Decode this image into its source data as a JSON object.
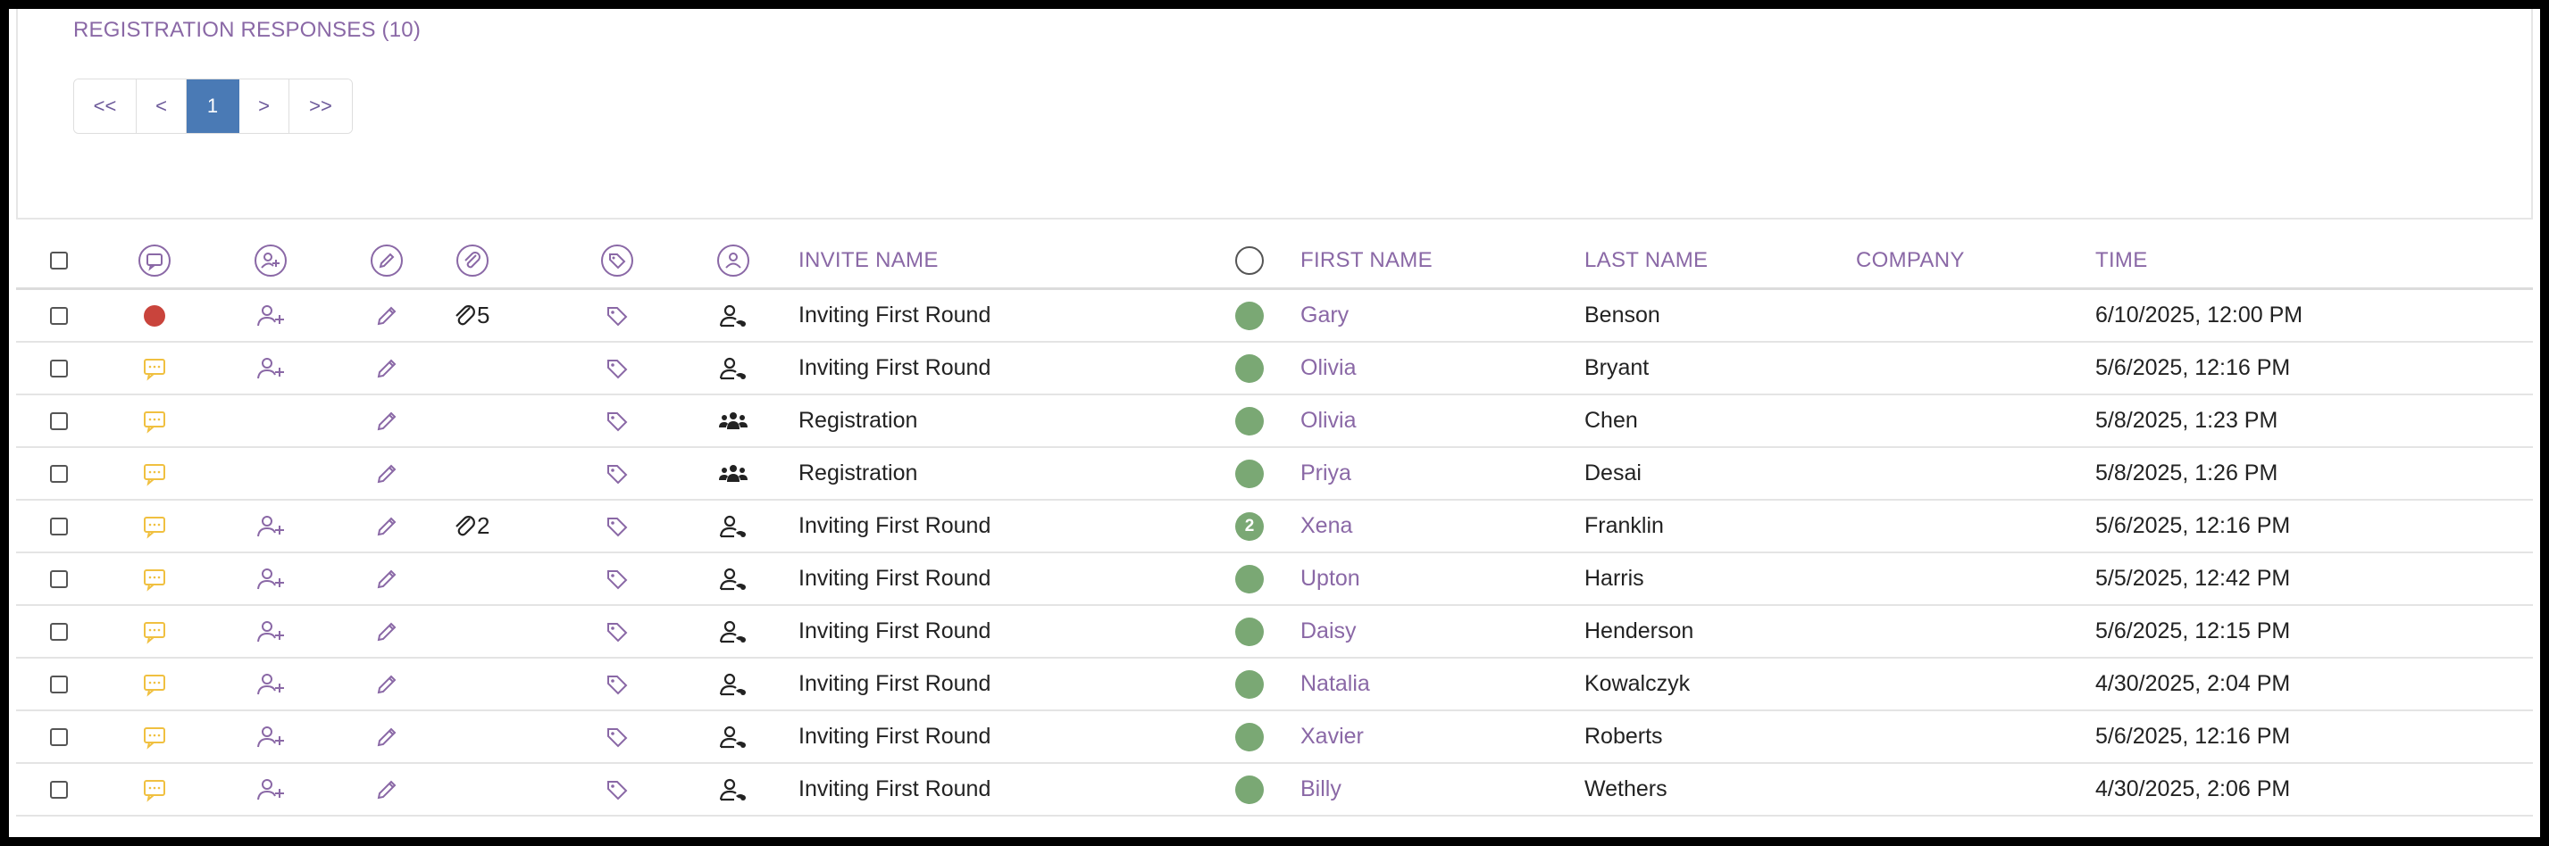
{
  "panel": {
    "title": "REGISTRATION RESPONSES (10)",
    "pager": {
      "first": "<<",
      "prev": "<",
      "current": "1",
      "next": ">",
      "last": ">>"
    }
  },
  "colors": {
    "accent_purple": "#8a68a6",
    "pager_active": "#4a7ab5",
    "status_green": "#7aa874",
    "alert_red": "#c9443c",
    "comment_yellow": "#f0c040"
  },
  "table": {
    "headers": {
      "comments": "comments-icon",
      "add_user": "user-plus-icon",
      "edit": "pencil-icon",
      "attachments": "paperclip-icon",
      "tags": "tag-icon",
      "person": "user-icon",
      "invite_name": "INVITE NAME",
      "status": "circle-icon",
      "first_name": "FIRST NAME",
      "last_name": "LAST NAME",
      "company": "COMPANY",
      "time": "TIME"
    },
    "rows": [
      {
        "comment": "red-dot",
        "add_user": true,
        "attachments": "5",
        "type": "user-lock-icon",
        "invite_name": "Inviting First Round",
        "status_badge": "",
        "first_name": "Gary",
        "last_name": "Benson",
        "company": "",
        "time": "6/10/2025, 12:00 PM"
      },
      {
        "comment": "chat",
        "add_user": true,
        "attachments": "",
        "type": "user-lock-icon",
        "invite_name": "Inviting First Round",
        "status_badge": "",
        "first_name": "Olivia",
        "last_name": "Bryant",
        "company": "",
        "time": "5/6/2025, 12:16 PM"
      },
      {
        "comment": "chat",
        "add_user": false,
        "attachments": "",
        "type": "group-icon",
        "invite_name": "Registration",
        "status_badge": "",
        "first_name": "Olivia",
        "last_name": "Chen",
        "company": "",
        "time": "5/8/2025, 1:23 PM"
      },
      {
        "comment": "chat",
        "add_user": false,
        "attachments": "",
        "type": "group-icon",
        "invite_name": "Registration",
        "status_badge": "",
        "first_name": "Priya",
        "last_name": "Desai",
        "company": "",
        "time": "5/8/2025, 1:26 PM"
      },
      {
        "comment": "chat",
        "add_user": true,
        "attachments": "2",
        "type": "user-lock-icon",
        "invite_name": "Inviting First Round",
        "status_badge": "2",
        "first_name": "Xena",
        "last_name": "Franklin",
        "company": "",
        "time": "5/6/2025, 12:16 PM"
      },
      {
        "comment": "chat",
        "add_user": true,
        "attachments": "",
        "type": "user-lock-icon",
        "invite_name": "Inviting First Round",
        "status_badge": "",
        "first_name": "Upton",
        "last_name": "Harris",
        "company": "",
        "time": "5/5/2025, 12:42 PM"
      },
      {
        "comment": "chat",
        "add_user": true,
        "attachments": "",
        "type": "user-lock-icon",
        "invite_name": "Inviting First Round",
        "status_badge": "",
        "first_name": "Daisy",
        "last_name": "Henderson",
        "company": "",
        "time": "5/6/2025, 12:15 PM"
      },
      {
        "comment": "chat",
        "add_user": true,
        "attachments": "",
        "type": "user-lock-icon",
        "invite_name": "Inviting First Round",
        "status_badge": "",
        "first_name": "Natalia",
        "last_name": "Kowalczyk",
        "company": "",
        "time": "4/30/2025, 2:04 PM"
      },
      {
        "comment": "chat",
        "add_user": true,
        "attachments": "",
        "type": "user-lock-icon",
        "invite_name": "Inviting First Round",
        "status_badge": "",
        "first_name": "Xavier",
        "last_name": "Roberts",
        "company": "",
        "time": "5/6/2025, 12:16 PM"
      },
      {
        "comment": "chat",
        "add_user": true,
        "attachments": "",
        "type": "user-lock-icon",
        "invite_name": "Inviting First Round",
        "status_badge": "",
        "first_name": "Billy",
        "last_name": "Wethers",
        "company": "",
        "time": "4/30/2025, 2:06 PM"
      }
    ]
  }
}
